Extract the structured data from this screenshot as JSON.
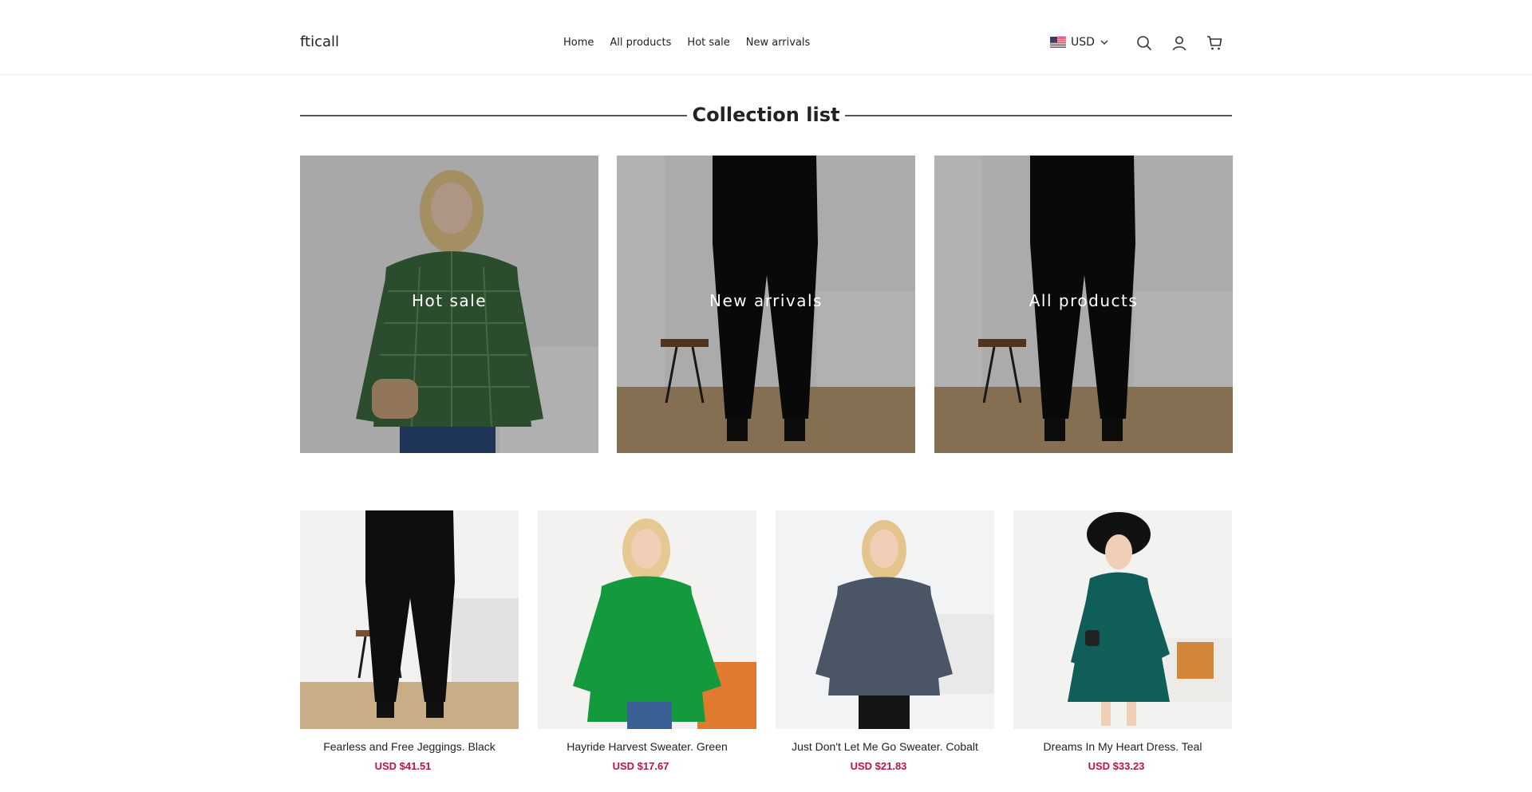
{
  "header": {
    "logo": "fticall",
    "nav": [
      "Home",
      "All products",
      "Hot sale",
      "New arrivals"
    ],
    "currency": "USD",
    "icons": [
      "us-flag-icon",
      "chevron-down-icon",
      "search-icon",
      "account-icon",
      "cart-icon"
    ]
  },
  "collection": {
    "title": "Collection list",
    "items": [
      {
        "label": "Hot sale",
        "garment_color": "#3d6b3f"
      },
      {
        "label": "New arrivals",
        "garment_color": "#0d0d0d"
      },
      {
        "label": "All products",
        "garment_color": "#0d0d0d"
      }
    ]
  },
  "products": [
    {
      "name": "Fearless and Free Jeggings. Black",
      "price": "USD $41.51",
      "garment_color": "#0e0e0e"
    },
    {
      "name": "Hayride Harvest Sweater. Green",
      "price": "USD $17.67",
      "garment_color": "#139a3c"
    },
    {
      "name": "Just Don't Let Me Go Sweater. Cobalt",
      "price": "USD $21.83",
      "garment_color": "#4a5566"
    },
    {
      "name": "Dreams In My Heart Dress. Teal",
      "price": "USD $33.23",
      "garment_color": "#0f5e57"
    }
  ],
  "colors": {
    "price": "#b3164f",
    "text": "#222222",
    "rule": "#555555"
  }
}
